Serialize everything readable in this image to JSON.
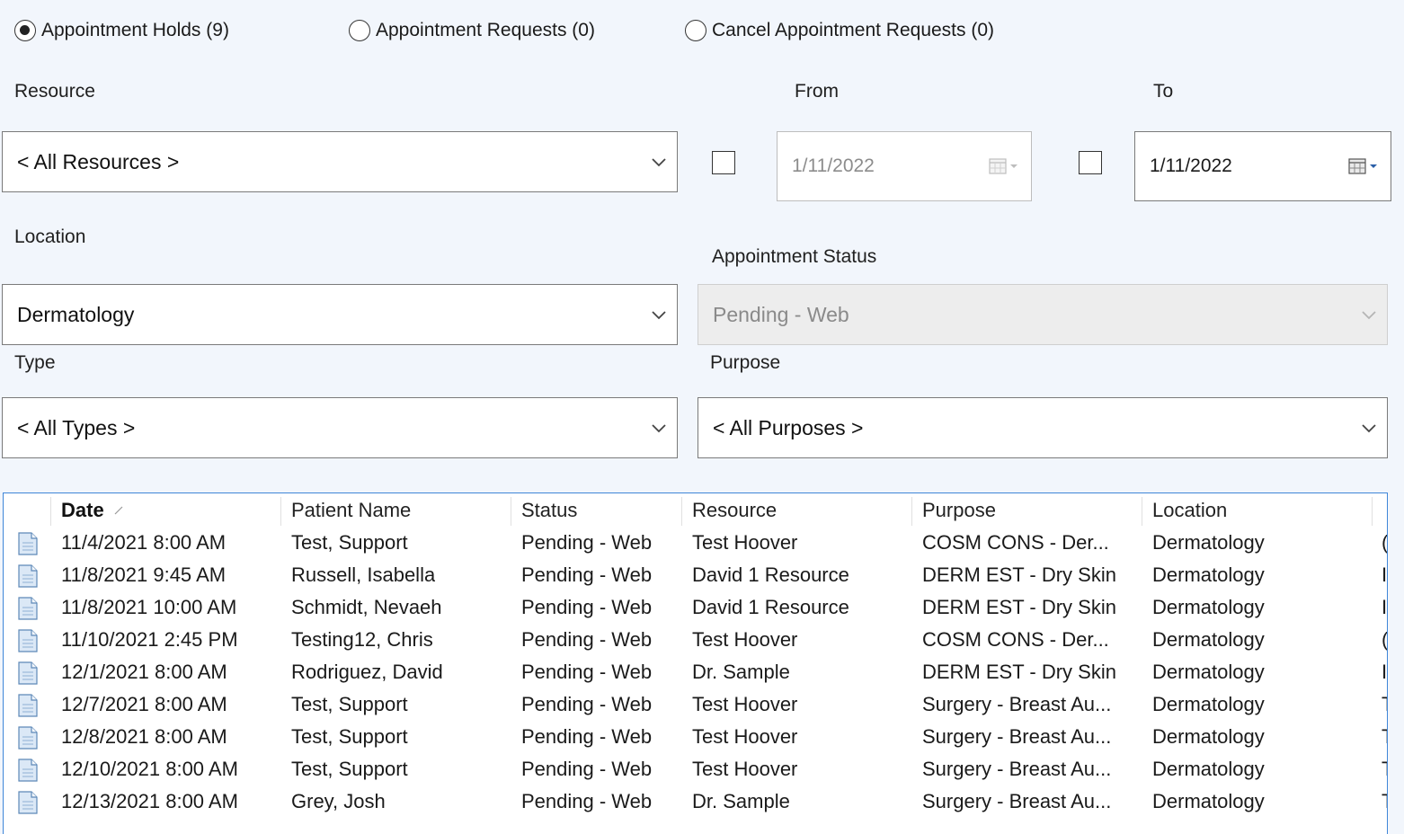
{
  "radios": [
    {
      "label": "Appointment Holds (9)",
      "checked": true
    },
    {
      "label": "Appointment Requests (0)",
      "checked": false
    },
    {
      "label": "Cancel Appointment Requests (0)",
      "checked": false
    }
  ],
  "filters": {
    "resource_label": "Resource",
    "resource_value": "< All Resources >",
    "from_label": "From",
    "from_value": "1/11/2022",
    "to_label": "To",
    "to_value": "1/11/2022",
    "location_label": "Location",
    "location_value": "Dermatology",
    "status_label": "Appointment Status",
    "status_value": "Pending - Web",
    "type_label": "Type",
    "type_value": "< All Types >",
    "purpose_label": "Purpose",
    "purpose_value": "< All Purposes >"
  },
  "grid": {
    "columns": [
      "Date",
      "Patient Name",
      "Status",
      "Resource",
      "Purpose",
      "Location"
    ],
    "rows": [
      {
        "date": "11/4/2021 8:00 AM",
        "patient": "Test, Support",
        "status": "Pending - Web",
        "resource": "Test Hoover",
        "purpose": "COSM CONS - Der...",
        "location": "Dermatology",
        "extra": "("
      },
      {
        "date": "11/8/2021 9:45 AM",
        "patient": "Russell, Isabella",
        "status": "Pending - Web",
        "resource": "David 1 Resource",
        "purpose": "DERM EST - Dry Skin",
        "location": "Dermatology",
        "extra": "I"
      },
      {
        "date": "11/8/2021 10:00 AM",
        "patient": "Schmidt, Nevaeh",
        "status": "Pending - Web",
        "resource": "David 1 Resource",
        "purpose": "DERM EST - Dry Skin",
        "location": "Dermatology",
        "extra": "I"
      },
      {
        "date": "11/10/2021 2:45 PM",
        "patient": "Testing12, Chris",
        "status": "Pending - Web",
        "resource": "Test Hoover",
        "purpose": "COSM CONS - Der...",
        "location": "Dermatology",
        "extra": "("
      },
      {
        "date": "12/1/2021 8:00 AM",
        "patient": "Rodriguez, David",
        "status": "Pending - Web",
        "resource": "Dr. Sample",
        "purpose": "DERM EST - Dry Skin",
        "location": "Dermatology",
        "extra": "I"
      },
      {
        "date": "12/7/2021 8:00 AM",
        "patient": "Test, Support",
        "status": "Pending - Web",
        "resource": "Test Hoover",
        "purpose": "Surgery - Breast Au...",
        "location": "Dermatology",
        "extra": "T"
      },
      {
        "date": "12/8/2021 8:00 AM",
        "patient": "Test, Support",
        "status": "Pending - Web",
        "resource": "Test Hoover",
        "purpose": "Surgery - Breast Au...",
        "location": "Dermatology",
        "extra": "T"
      },
      {
        "date": "12/10/2021 8:00 AM",
        "patient": "Test, Support",
        "status": "Pending - Web",
        "resource": "Test Hoover",
        "purpose": "Surgery - Breast Au...",
        "location": "Dermatology",
        "extra": "T"
      },
      {
        "date": "12/13/2021 8:00 AM",
        "patient": "Grey, Josh",
        "status": "Pending - Web",
        "resource": "Dr. Sample",
        "purpose": "Surgery - Breast Au...",
        "location": "Dermatology",
        "extra": "T"
      }
    ]
  },
  "icons": {
    "row_icon": "document-icon",
    "dropdown": "chevron-down-icon",
    "calendar": "calendar-icon",
    "sort": "sort-ascending-icon"
  },
  "colors": {
    "background": "#f2f6fc",
    "grid_border": "#3f86d8",
    "disabled_bg": "#ededed"
  }
}
